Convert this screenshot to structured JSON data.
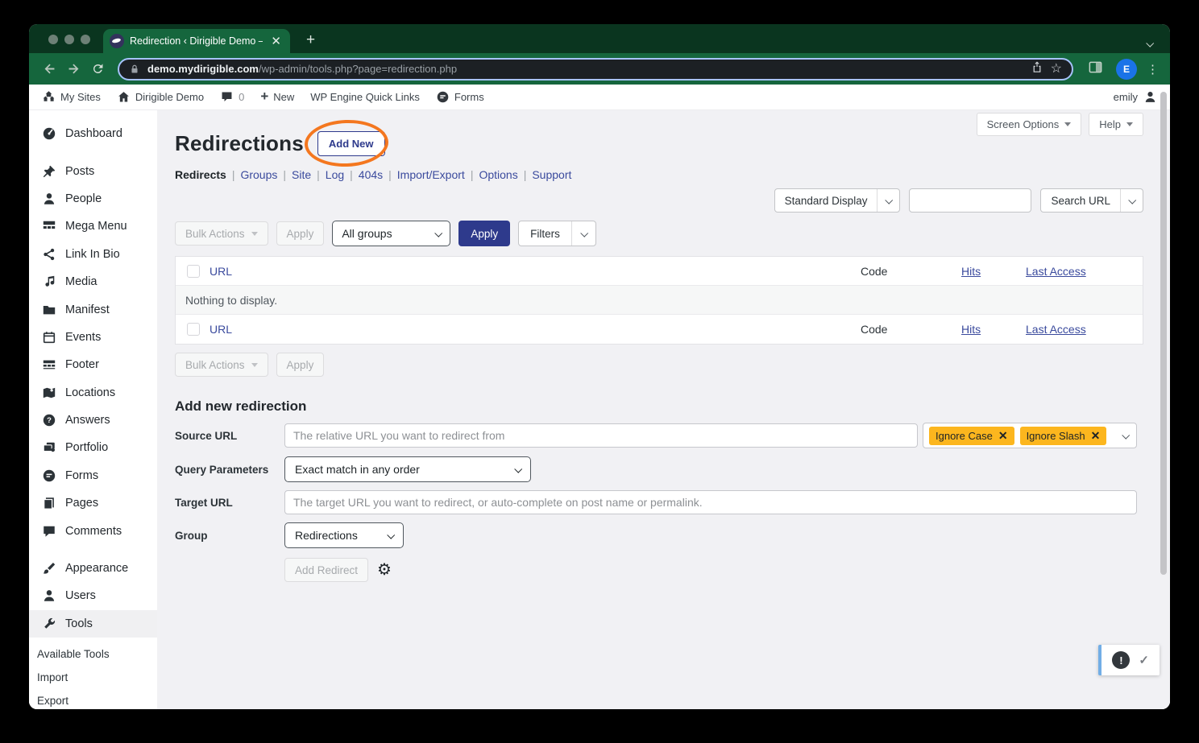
{
  "browser": {
    "tab_title": "Redirection ‹ Dirigible Demo —",
    "url_domain": "demo.mydirigible.com",
    "url_path": "/wp-admin/tools.php?page=redirection.php",
    "avatar_letter": "E"
  },
  "admin_bar": {
    "my_sites": "My Sites",
    "site_name": "Dirigible Demo",
    "comment_count": "0",
    "new_label": "New",
    "wpe_label": "WP Engine Quick Links",
    "forms_label": "Forms",
    "user_name": "emily"
  },
  "sidebar": {
    "items": [
      {
        "label": "Dashboard",
        "icon": "gauge"
      },
      {
        "label": "Posts",
        "icon": "pin",
        "gap": true
      },
      {
        "label": "People",
        "icon": "person"
      },
      {
        "label": "Mega Menu",
        "icon": "grid"
      },
      {
        "label": "Link In Bio",
        "icon": "share"
      },
      {
        "label": "Media",
        "icon": "media"
      },
      {
        "label": "Manifest",
        "icon": "folder"
      },
      {
        "label": "Events",
        "icon": "calendar"
      },
      {
        "label": "Footer",
        "icon": "grid-footer"
      },
      {
        "label": "Locations",
        "icon": "map"
      },
      {
        "label": "Answers",
        "icon": "question"
      },
      {
        "label": "Portfolio",
        "icon": "portfolio"
      },
      {
        "label": "Forms",
        "icon": "forms"
      },
      {
        "label": "Pages",
        "icon": "pages"
      },
      {
        "label": "Comments",
        "icon": "comment"
      },
      {
        "label": "Appearance",
        "icon": "brush",
        "gap": true
      },
      {
        "label": "Users",
        "icon": "person"
      },
      {
        "label": "Tools",
        "icon": "wrench",
        "active": true
      }
    ],
    "submenu": [
      "Available Tools",
      "Import",
      "Export"
    ]
  },
  "main": {
    "title": "Redirections",
    "add_new": "Add New",
    "screen_options": "Screen Options",
    "help": "Help",
    "nav_tabs": [
      "Redirects",
      "Groups",
      "Site",
      "Log",
      "404s",
      "Import/Export",
      "Options",
      "Support"
    ],
    "display_select": "Standard Display",
    "search_button": "Search URL",
    "bulk_actions": "Bulk Actions",
    "apply": "Apply",
    "all_groups": "All groups",
    "filters": "Filters",
    "table": {
      "headers": {
        "url": "URL",
        "code": "Code",
        "hits": "Hits",
        "last_access": "Last Access"
      },
      "empty": "Nothing to display."
    },
    "form": {
      "heading": "Add new redirection",
      "source_label": "Source URL",
      "source_placeholder": "The relative URL you want to redirect from",
      "flags": [
        "Ignore Case",
        "Ignore Slash"
      ],
      "query_label": "Query Parameters",
      "query_value": "Exact match in any order",
      "target_label": "Target URL",
      "target_placeholder": "The target URL you want to redirect, or auto-complete on post name or permalink.",
      "group_label": "Group",
      "group_value": "Redirections",
      "add_redirect": "Add Redirect"
    }
  },
  "colors": {
    "chrome_green": "#15663d",
    "chrome_dark_green": "#0a351f",
    "brand_navy": "#2e3a8c",
    "link_blue": "#3a4a9d",
    "flag_yellow": "#fcb61e",
    "annotation_orange": "#f4771f",
    "notice_blue": "#72aee6"
  }
}
